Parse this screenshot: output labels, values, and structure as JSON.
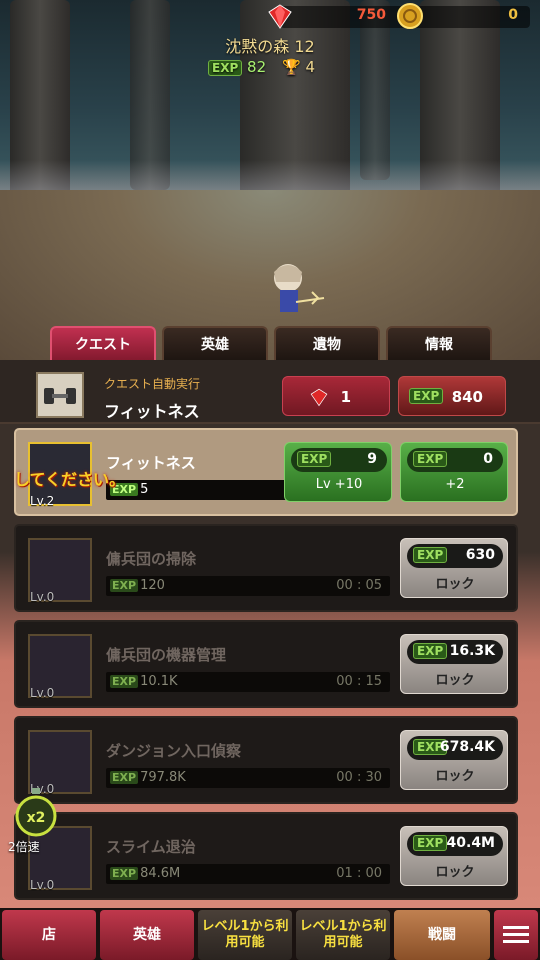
{
  "hud": {
    "gems": "750",
    "gold": "0",
    "stage": "沈黙の森 12",
    "exp_label": "EXP",
    "exp": "82",
    "trophies": "4"
  },
  "tabs": [
    {
      "label": "クエスト"
    },
    {
      "label": "英雄"
    },
    {
      "label": "遺物"
    },
    {
      "label": "情報"
    }
  ],
  "auto": {
    "label": "クエスト自動実行",
    "name": "フィットネス",
    "gem_cost": "1",
    "exp_cost": "840"
  },
  "hint": "してください。",
  "speed": {
    "badge": "x2",
    "label": "2倍速"
  },
  "quests": [
    {
      "name": "フィットネス",
      "level": "Lv.2",
      "exp": "5",
      "time": "",
      "upgrade_exp": "9",
      "upgrade_label": "Lv +10",
      "upgrade2_exp": "0",
      "upgrade2_label": "+2"
    },
    {
      "name": "傭兵団の掃除",
      "level": "Lv.0",
      "exp": "120",
      "time": "00 : 05",
      "unlock_exp": "630",
      "lock_label": "ロック"
    },
    {
      "name": "傭兵団の機器管理",
      "level": "Lv.0",
      "exp": "10.1K",
      "time": "00 : 15",
      "unlock_exp": "16.3K",
      "lock_label": "ロック"
    },
    {
      "name": "ダンジョン入口偵察",
      "level": "Lv.0",
      "exp": "797.8K",
      "time": "00 : 30",
      "unlock_exp": "678.4K",
      "lock_label": "ロック"
    },
    {
      "name": "スライム退治",
      "level": "Lv.0",
      "exp": "84.6M",
      "time": "01 : 00",
      "unlock_exp": "40.4M",
      "lock_label": "ロック"
    }
  ],
  "nav": {
    "shop": "店",
    "hero": "英雄",
    "locked1": "レベル1から利用可能",
    "locked2": "レベル1から利用可能",
    "battle": "戦闘"
  },
  "colors": {
    "accent": "#c03050",
    "gem": "#f55a3a",
    "gold": "#f0c040",
    "exp_green": "#9fe060"
  }
}
